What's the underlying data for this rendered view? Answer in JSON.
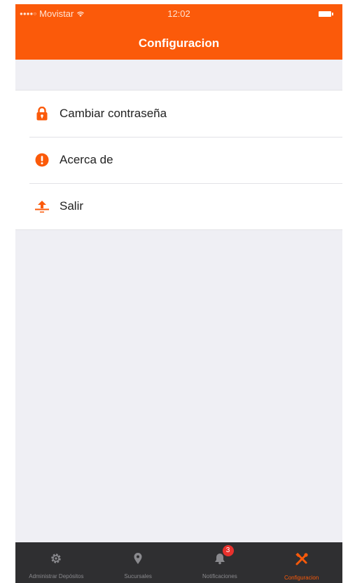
{
  "status_bar": {
    "carrier": "Movistar",
    "time": "12:02"
  },
  "header": {
    "title": "Configuracion"
  },
  "menu": {
    "items": [
      {
        "label": "Cambiar contraseña",
        "icon": "lock-icon"
      },
      {
        "label": "Acerca de",
        "icon": "info-icon"
      },
      {
        "label": "Salir",
        "icon": "exit-icon"
      }
    ]
  },
  "tabbar": {
    "tabs": [
      {
        "label": "Administrar Depósitos",
        "icon": "gear-icon"
      },
      {
        "label": "Sucursales",
        "icon": "location-pin-icon"
      },
      {
        "label": "Notificaciones",
        "icon": "bell-icon",
        "badge": "3"
      },
      {
        "label": "Configuracion",
        "icon": "tools-icon",
        "active": true
      }
    ]
  },
  "colors": {
    "accent": "#fb5a0a",
    "tabbar": "#2f2f31",
    "background": "#efeff4",
    "badge": "#e8312d"
  }
}
